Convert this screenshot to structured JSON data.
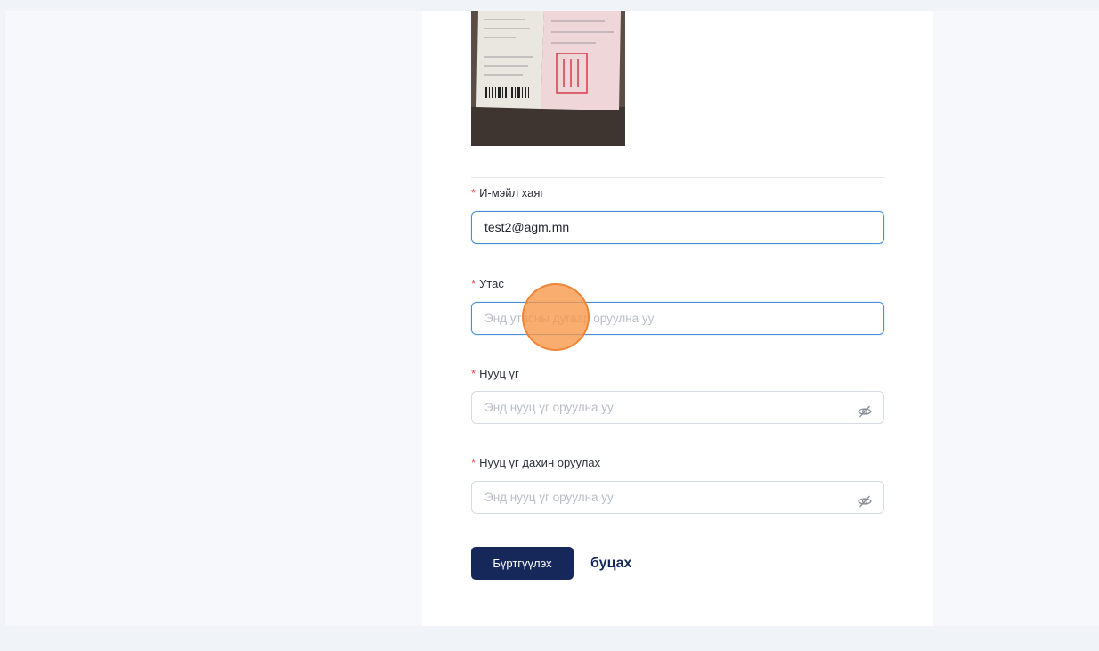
{
  "form": {
    "email": {
      "label": "И-мэйл хаяг",
      "value": "test2@agm.mn"
    },
    "phone": {
      "label": "Утас",
      "placeholder": "Энд утасны дугаар оруулна уу"
    },
    "password": {
      "label": "Нууц үг",
      "placeholder": "Энд нууц үг оруулна уу"
    },
    "password_confirm": {
      "label": "Нууц үг дахин оруулах",
      "placeholder": "Энд нууц үг оруулна уу"
    },
    "required_mark": "*"
  },
  "actions": {
    "register_label": "Бүртгүүлэх",
    "back_label": "буцах"
  },
  "icons": {
    "password_toggle": "eye-off-icon"
  },
  "colors": {
    "primary": "#16285a",
    "focus": "#4a90d9",
    "required": "#e5484d",
    "click_indicator": "#f79646"
  }
}
